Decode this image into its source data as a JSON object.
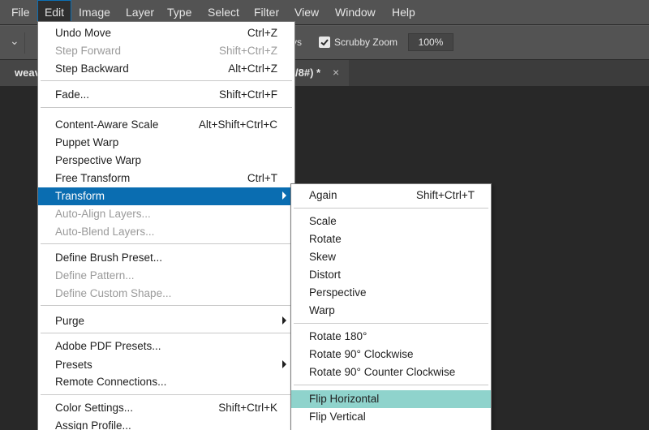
{
  "menubar": {
    "items": [
      "File",
      "Edit",
      "Image",
      "Layer",
      "Type",
      "Select",
      "Filter",
      "View",
      "Window",
      "Help"
    ]
  },
  "options": {
    "partial_label": "vs",
    "scrubby_zoom_label": "Scrubby Zoom",
    "scrubby_zoom_checked": true,
    "zoom_value": "100%"
  },
  "tabbar": {
    "doc_tab_start": "weav",
    "doc_tab_end": "/8#) *",
    "close_glyph": "×"
  },
  "edit_menu": {
    "items": [
      {
        "label": "Undo Move",
        "shortcut": "Ctrl+Z",
        "enabled": true
      },
      {
        "label": "Step Forward",
        "shortcut": "Shift+Ctrl+Z",
        "enabled": false
      },
      {
        "label": "Step Backward",
        "shortcut": "Alt+Ctrl+Z",
        "enabled": true
      },
      {
        "label": "Fade...",
        "shortcut": "Shift+Ctrl+F",
        "enabled": true
      },
      {
        "label": "Content-Aware Scale",
        "shortcut": "Alt+Shift+Ctrl+C",
        "enabled": true
      },
      {
        "label": "Puppet Warp",
        "shortcut": "",
        "enabled": true
      },
      {
        "label": "Perspective Warp",
        "shortcut": "",
        "enabled": true
      },
      {
        "label": "Free Transform",
        "shortcut": "Ctrl+T",
        "enabled": true
      },
      {
        "label": "Transform",
        "shortcut": "",
        "enabled": true,
        "submenu": true,
        "highlighted": true
      },
      {
        "label": "Auto-Align Layers...",
        "shortcut": "",
        "enabled": false
      },
      {
        "label": "Auto-Blend Layers...",
        "shortcut": "",
        "enabled": false
      },
      {
        "label": "Define Brush Preset...",
        "shortcut": "",
        "enabled": true
      },
      {
        "label": "Define Pattern...",
        "shortcut": "",
        "enabled": false
      },
      {
        "label": "Define Custom Shape...",
        "shortcut": "",
        "enabled": false
      },
      {
        "label": "Purge",
        "shortcut": "",
        "enabled": true,
        "submenu": true
      },
      {
        "label": "Adobe PDF Presets...",
        "shortcut": "",
        "enabled": true
      },
      {
        "label": "Presets",
        "shortcut": "",
        "enabled": true,
        "submenu": true
      },
      {
        "label": "Remote Connections...",
        "shortcut": "",
        "enabled": true
      },
      {
        "label": "Color Settings...",
        "shortcut": "Shift+Ctrl+K",
        "enabled": true
      },
      {
        "label": "Assign Profile...",
        "shortcut": "",
        "enabled": true
      }
    ]
  },
  "transform_menu": {
    "items": [
      {
        "label": "Again",
        "shortcut": "Shift+Ctrl+T"
      },
      {
        "label": "Scale",
        "shortcut": ""
      },
      {
        "label": "Rotate",
        "shortcut": ""
      },
      {
        "label": "Skew",
        "shortcut": ""
      },
      {
        "label": "Distort",
        "shortcut": ""
      },
      {
        "label": "Perspective",
        "shortcut": ""
      },
      {
        "label": "Warp",
        "shortcut": ""
      },
      {
        "label": "Rotate 180°",
        "shortcut": ""
      },
      {
        "label": "Rotate 90° Clockwise",
        "shortcut": ""
      },
      {
        "label": "Rotate 90° Counter Clockwise",
        "shortcut": ""
      },
      {
        "label": "Flip Horizontal",
        "shortcut": "",
        "highlighted": true
      },
      {
        "label": "Flip Vertical",
        "shortcut": ""
      }
    ]
  }
}
